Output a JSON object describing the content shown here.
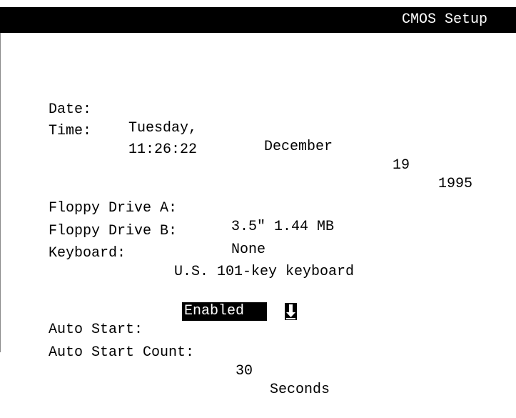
{
  "title": "CMOS Setup",
  "datetime": {
    "date_label": "Date:",
    "weekday": "Tuesday,",
    "month": "December",
    "day": "19",
    "year": "1995",
    "time_label": "Time:",
    "time": "11:26:22"
  },
  "drives": {
    "floppy_a_label": "Floppy Drive A:",
    "floppy_a_value": "3.5\" 1.44 MB",
    "floppy_b_label": "Floppy Drive B:",
    "floppy_b_value": "None",
    "keyboard_label": "Keyboard:",
    "keyboard_value": "U.S. 101-key keyboard"
  },
  "autostart": {
    "label": "Auto Start:",
    "value": "Enabled",
    "count_label": "Auto Start Count:",
    "count_value": "30",
    "count_unit": "Seconds"
  },
  "icons": {
    "dropdown": "down-arrow-icon"
  }
}
